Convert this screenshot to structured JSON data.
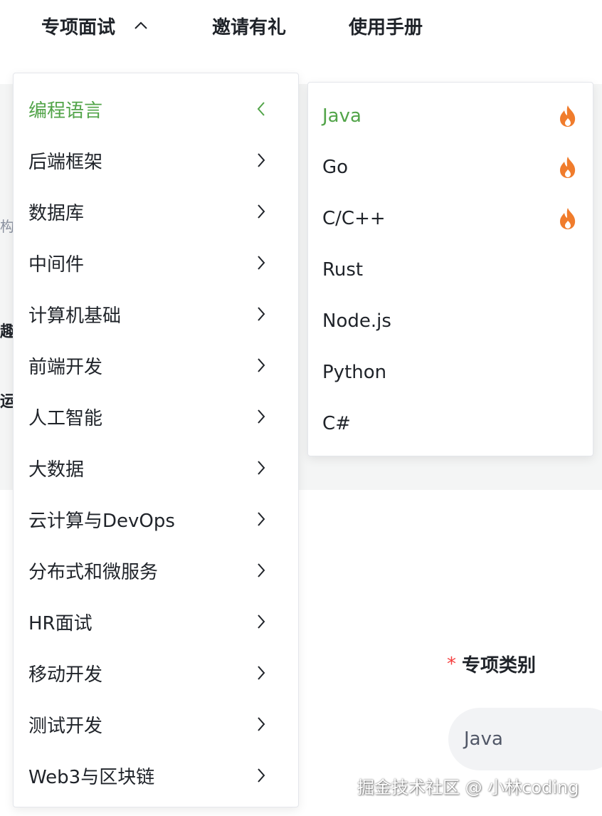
{
  "topnav": {
    "items": [
      {
        "label": "专项面试",
        "expanded": true
      },
      {
        "label": "邀请有礼"
      },
      {
        "label": "使用手册"
      }
    ]
  },
  "background": {
    "peek_texts": [
      "构",
      "趣",
      "运"
    ],
    "form": {
      "required_mark": "*",
      "label": "专项类别",
      "select_value": "Java"
    },
    "watermark": "掘金技术社区 @ 小林coding"
  },
  "menu": {
    "items": [
      {
        "label": "编程语言",
        "active": true
      },
      {
        "label": "后端框架"
      },
      {
        "label": "数据库"
      },
      {
        "label": "中间件"
      },
      {
        "label": "计算机基础"
      },
      {
        "label": "前端开发"
      },
      {
        "label": "人工智能"
      },
      {
        "label": "大数据"
      },
      {
        "label": "云计算与DevOps"
      },
      {
        "label": "分布式和微服务"
      },
      {
        "label": "HR面试"
      },
      {
        "label": "移动开发"
      },
      {
        "label": "测试开发"
      },
      {
        "label": "Web3与区块链"
      }
    ]
  },
  "submenu": {
    "items": [
      {
        "label": "Java",
        "active": true,
        "hot": true
      },
      {
        "label": "Go",
        "hot": true
      },
      {
        "label": "C/C++",
        "hot": true
      },
      {
        "label": "Rust"
      },
      {
        "label": "Node.js"
      },
      {
        "label": "Python"
      },
      {
        "label": "C#"
      }
    ]
  },
  "colors": {
    "accent_green": "#52a449",
    "hot_orange": "#f07c2c",
    "required_red": "#f53f3f"
  },
  "icons": {
    "caret_up": "chevron-up-icon",
    "chevron_right": "chevron-right-icon",
    "chevron_left": "chevron-left-icon",
    "hot": "fire-icon"
  }
}
